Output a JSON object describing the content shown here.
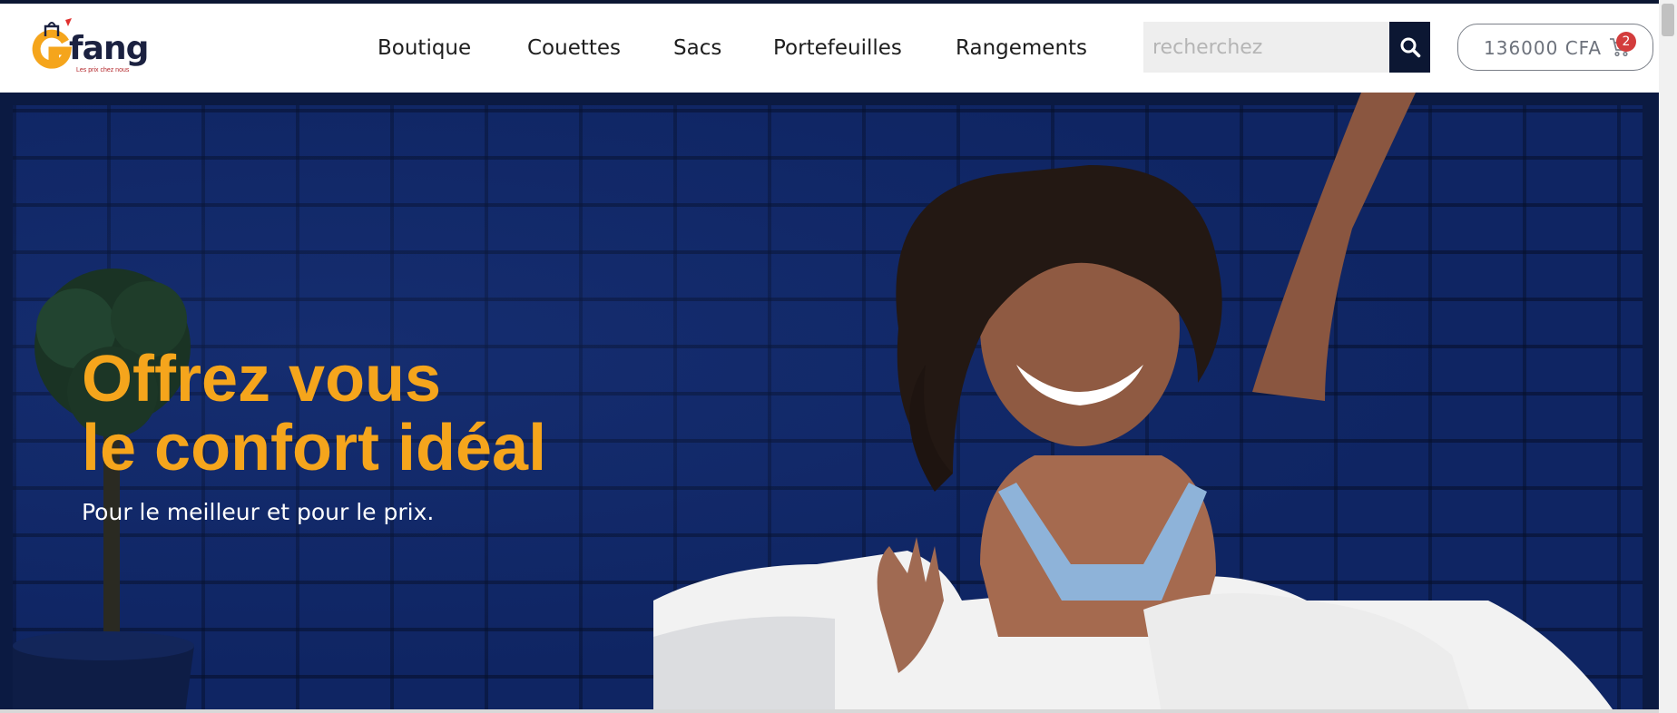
{
  "brand": {
    "name": "fang",
    "tagline": "Les prix chez nous",
    "colors": {
      "navy": "#0c1733",
      "orange": "#f5a51c",
      "red": "#d33c3c"
    }
  },
  "nav": {
    "items": [
      {
        "label": "Boutique"
      },
      {
        "label": "Couettes"
      },
      {
        "label": "Sacs"
      },
      {
        "label": "Portefeuilles"
      },
      {
        "label": "Rangements"
      }
    ]
  },
  "search": {
    "placeholder": "recherchez",
    "button_icon": "search-icon"
  },
  "cart": {
    "amount": "136000 CFA",
    "count": "2",
    "icon": "cart-icon"
  },
  "hero": {
    "title_line1": "Offrez vous",
    "title_line2": "le confort idéal",
    "subtitle": "Pour le meilleur et pour le prix."
  }
}
